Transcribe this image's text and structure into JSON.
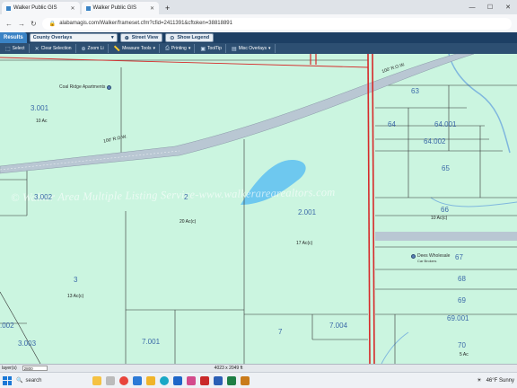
{
  "browser": {
    "tabs": [
      {
        "label": "Walker Public GIS",
        "active": true
      },
      {
        "label": "Walker Public GIS",
        "active": true
      }
    ],
    "new_tab": "+",
    "url": "alabamagis.com/Walker/frameset.cfm?cfid=2411391&cftoken=38818891"
  },
  "app": {
    "results_tab": "Results",
    "layer_select": "County Overlays",
    "street_view": "Street View",
    "show_legend": "Show Legend"
  },
  "tools": [
    {
      "label": "Select",
      "icon": "select-icon"
    },
    {
      "label": "Clear Selection",
      "icon": "clear-icon"
    },
    {
      "label": "Zoom Li",
      "icon": "zoom-icon"
    },
    {
      "label": "Measure Tools",
      "icon": "measure-icon"
    },
    {
      "label": "Printing",
      "icon": "print-icon"
    },
    {
      "label": "ToolTip",
      "icon": "tooltip-icon"
    },
    {
      "label": "Misc Overlays",
      "icon": "overlay-icon"
    }
  ],
  "map": {
    "watermark": "© Walker Area Multiple Listing Service-www.walkerarearealtors.com",
    "road_label": "100' R.O.W.",
    "road_label_right": "100' R.O.W.",
    "poi_1": "Coal Ridge Apartments",
    "poi_2": "Dees Wholesale",
    "poi_2_sub": "Car Brokers",
    "parcels": [
      {
        "id": "3.001",
        "acres": "10 Ac"
      },
      {
        "id": "3.002",
        "acres": ""
      },
      {
        "id": "2",
        "acres": "20 Ac(c)"
      },
      {
        "id": "2.001",
        "acres": "17 Ac(c)"
      },
      {
        "id": "3",
        "acres": "13 Ac(c)"
      },
      {
        "id": "7.001",
        "acres": ""
      },
      {
        "id": "7",
        "acres": ""
      },
      {
        "id": "7.004",
        "acres": ""
      },
      {
        "id": "3.003",
        "acres": ""
      },
      {
        "id": "63",
        "acres": ""
      },
      {
        "id": "64",
        "acres": ""
      },
      {
        "id": "64.001",
        "acres": ""
      },
      {
        "id": "64.002",
        "acres": ""
      },
      {
        "id": "65",
        "acres": ""
      },
      {
        "id": "66",
        "acres": "10 Ac(c)"
      },
      {
        "id": "67",
        "acres": ""
      },
      {
        "id": "68",
        "acres": ""
      },
      {
        "id": "69",
        "acres": ""
      },
      {
        "id": "69.001",
        "acres": ""
      },
      {
        "id": "70",
        "acres": "5 Ac"
      },
      {
        "id": ".002",
        "acres": ""
      }
    ],
    "colors": {
      "parcel_fill": "#cbf5e0",
      "road": "#b9c7d3",
      "highway": "#d62a2a",
      "water": "#6ec8ef",
      "parcel_label": "#3c6aa8"
    }
  },
  "statusbar": {
    "layers": "layer(s)",
    "scale": "2800",
    "coords": "4023 x 2049 ft"
  },
  "taskbar": {
    "search_placeholder": "search",
    "weather": "46°F  Sunny"
  }
}
